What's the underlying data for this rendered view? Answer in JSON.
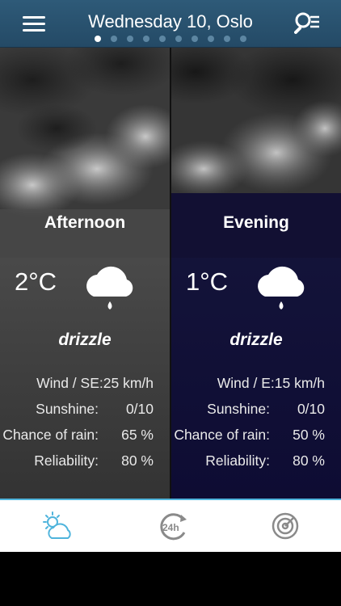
{
  "header": {
    "title": "Wednesday 10, Oslo",
    "page_count": 10,
    "active_page": 1
  },
  "panels": [
    {
      "title": "Afternoon",
      "temperature": "2°C",
      "condition": "drizzle",
      "icon": "cloud-drizzle-icon",
      "rows": [
        {
          "label": "Wind / SE:25 km/h",
          "value": ""
        },
        {
          "label": "Sunshine:",
          "value": "0/10"
        },
        {
          "label": "Chance of rain:",
          "value": "65 %"
        },
        {
          "label": "Reliability:",
          "value": "80 %"
        }
      ]
    },
    {
      "title": "Evening",
      "temperature": "1°C",
      "condition": "drizzle",
      "icon": "cloud-drizzle-icon",
      "rows": [
        {
          "label": "Wind / E:15 km/h",
          "value": ""
        },
        {
          "label": "Sunshine:",
          "value": "0/10"
        },
        {
          "label": "Chance of rain:",
          "value": "50 %"
        },
        {
          "label": "Reliability:",
          "value": "80 %"
        }
      ]
    }
  ],
  "tabbar": {
    "tabs": [
      {
        "icon": "partly-cloudy-icon",
        "active": true
      },
      {
        "icon": "24h-clock-icon",
        "label": "24h",
        "active": false
      },
      {
        "icon": "radar-icon",
        "active": false
      }
    ],
    "accent": "#4fb4dc"
  },
  "colors": {
    "header": "#2a5270",
    "left_panel": "#4a4a4a",
    "right_panel": "#0e0c33"
  }
}
